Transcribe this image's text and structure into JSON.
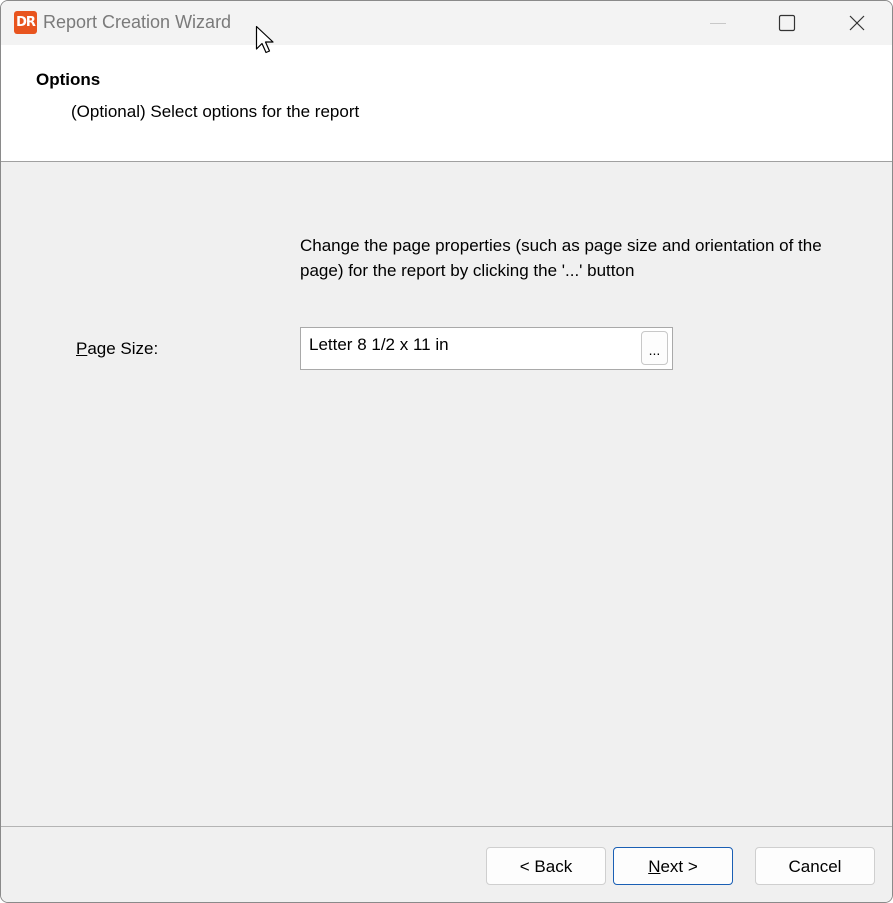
{
  "window": {
    "title": "Report Creation Wizard",
    "app_icon_text": "DR",
    "app_icon_color": "#e8541e"
  },
  "header": {
    "title": "Options",
    "subtitle": "(Optional) Select options for the report"
  },
  "main": {
    "instructions": "Change the page properties (such as page size and orientation of the page) for the report by clicking the '...' button",
    "page_size": {
      "label_mnemonic": "P",
      "label_rest": "age Size:",
      "value": "Letter 8 1/2 x 11 in",
      "browse_label": "..."
    }
  },
  "footer": {
    "back_label": "< Back",
    "next_mnemonic": "N",
    "next_rest": "ext >",
    "cancel_label": "Cancel"
  },
  "colors": {
    "accent_border": "#1a5fb4",
    "panel_background": "#f0f0f0"
  }
}
